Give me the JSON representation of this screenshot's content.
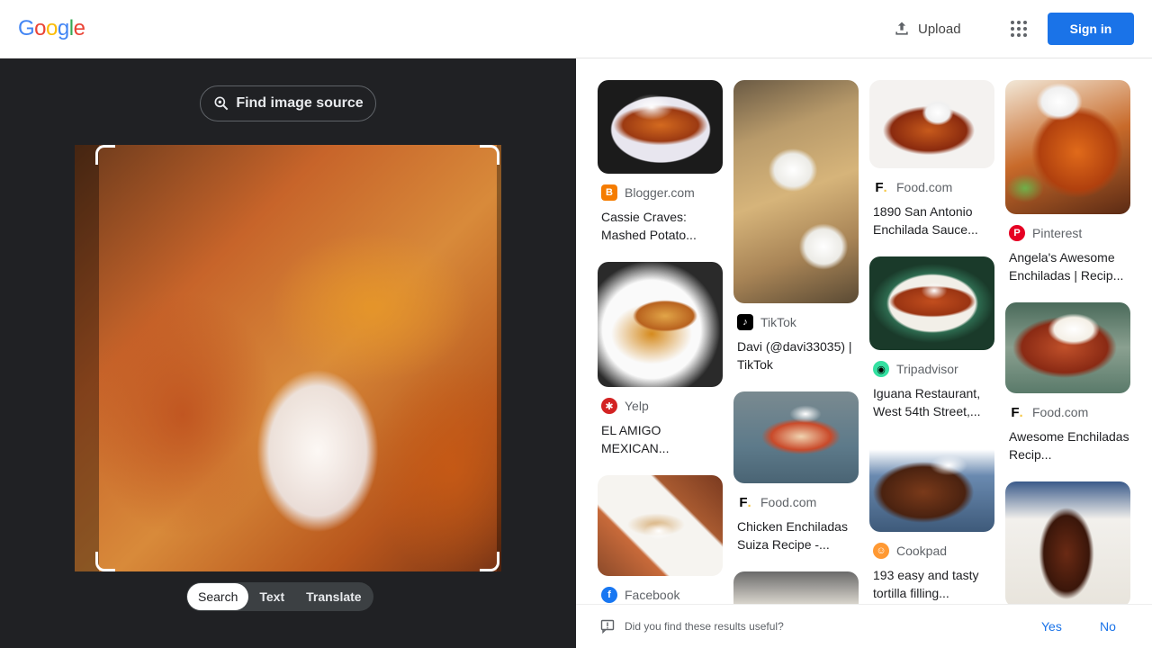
{
  "header": {
    "logo": [
      "G",
      "o",
      "o",
      "g",
      "l",
      "e"
    ],
    "logo_colors": [
      "#4285f4",
      "#ea4335",
      "#fbbc05",
      "#4285f4",
      "#34a853",
      "#ea4335"
    ],
    "upload_label": "Upload",
    "signin_label": "Sign in"
  },
  "left": {
    "find_source_label": "Find image source",
    "modes": [
      "Search",
      "Text",
      "Translate"
    ],
    "active_mode": "Search"
  },
  "results": {
    "col1": [
      {
        "source": "Blogger.com",
        "title": "Cassie Craves: Mashed Potato...",
        "fav_color": "#f57c00",
        "fav_glyph": "B"
      },
      {
        "source": "Yelp",
        "title": "EL AMIGO MEXICAN...",
        "fav_color": "#d32323",
        "fav_glyph": "✱"
      },
      {
        "source": "Facebook",
        "title": "",
        "fav_color": "#1877f2",
        "fav_glyph": "f"
      }
    ],
    "col2": [
      {
        "source": "TikTok",
        "title": "Davi (@davi33035) | TikTok",
        "fav_color": "#000000",
        "fav_glyph": "♪"
      },
      {
        "source": "Food.com",
        "title": "Chicken Enchiladas Suiza Recipe -...",
        "fav_color": "#ffffff",
        "fav_glyph": "F."
      }
    ],
    "col3": [
      {
        "source": "Food.com",
        "title": "1890 San Antonio Enchilada Sauce...",
        "fav_color": "#ffffff",
        "fav_glyph": "F."
      },
      {
        "source": "Tripadvisor",
        "title": "Iguana Restaurant, West 54th Street,...",
        "fav_color": "#34e0a1",
        "fav_glyph": "◉"
      },
      {
        "source": "Cookpad",
        "title": "193 easy and tasty tortilla filling...",
        "fav_color": "#ff9933",
        "fav_glyph": "☺"
      }
    ],
    "col4": [
      {
        "source": "Pinterest",
        "title": "Angela's Awesome Enchiladas | Recip...",
        "fav_color": "#e60023",
        "fav_glyph": "P"
      },
      {
        "source": "Food.com",
        "title": "Awesome Enchiladas Recip...",
        "fav_color": "#ffffff",
        "fav_glyph": "F."
      }
    ]
  },
  "footer": {
    "question": "Did you find these results useful?",
    "yes_label": "Yes",
    "no_label": "No"
  }
}
